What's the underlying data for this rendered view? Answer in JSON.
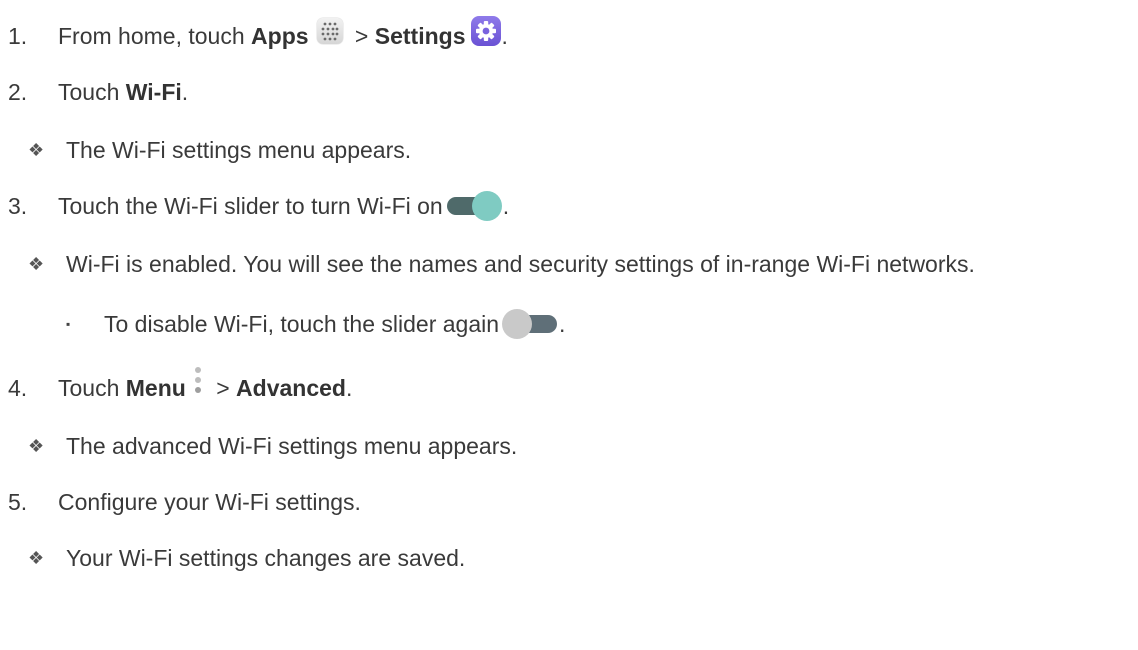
{
  "steps": [
    {
      "num": "1.",
      "prefix": "From home, touch ",
      "b1": "Apps",
      "mid": " > ",
      "b2": "Settings",
      "suffix": "."
    },
    {
      "num": "2.",
      "prefix": "Touch ",
      "b1": "Wi-Fi",
      "suffix": "."
    },
    {
      "bullet": "❖",
      "text": "The Wi-Fi settings menu appears."
    },
    {
      "num": "3.",
      "text": "Touch the Wi-Fi slider to turn Wi-Fi on",
      "suffix": "."
    },
    {
      "bullet": "❖",
      "text": "Wi-Fi is enabled. You will see the names and security settings of in-range Wi-Fi networks."
    },
    {
      "bullet": "▪",
      "text": "To disable Wi-Fi, touch the slider again",
      "suffix": "."
    },
    {
      "num": "4.",
      "prefix": "Touch ",
      "b1": "Menu",
      "mid": " > ",
      "b2": "Advanced",
      "suffix": "."
    },
    {
      "bullet": "❖",
      "text": "The advanced Wi-Fi settings menu appears."
    },
    {
      "num": "5.",
      "text": "Configure your Wi-Fi settings."
    },
    {
      "bullet": "❖",
      "text": "Your Wi-Fi settings changes are saved."
    }
  ],
  "icons": {
    "apps": "apps-grid-icon",
    "settings": "settings-gear-icon",
    "toggle_on": "toggle-on-icon",
    "toggle_off": "toggle-off-icon",
    "menu": "menu-dots-icon"
  },
  "colors": {
    "toggle_on_track": "#4f6a6a",
    "toggle_on_knob": "#7fcbc2",
    "toggle_off_track": "#5f6f78",
    "toggle_off_knob": "#c9c9c9",
    "settings_bg": "#7a63df"
  }
}
